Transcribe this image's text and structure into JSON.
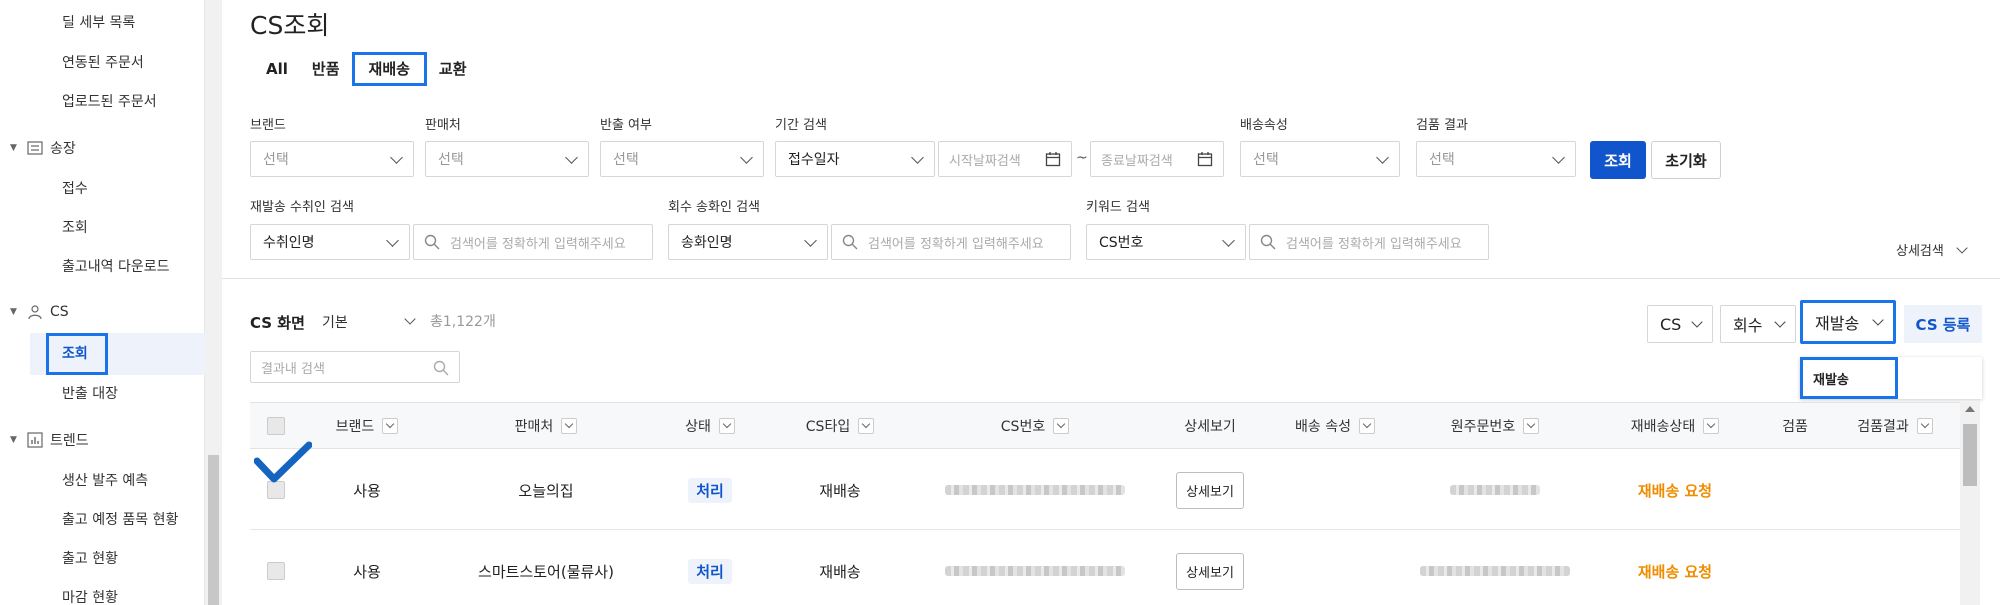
{
  "sidebar": {
    "items_top": [
      "딜 세부 목록",
      "연동된 주문서",
      "업로드된 주문서"
    ],
    "groups": [
      {
        "label": "송장",
        "icon": "document-icon",
        "items": [
          "접수",
          "조회",
          "출고내역 다운로드"
        ]
      },
      {
        "label": "CS",
        "icon": "user-icon",
        "items": [
          "조회",
          "반출 대장"
        ],
        "active_item": "조회"
      },
      {
        "label": "트렌드",
        "icon": "chart-icon",
        "items": [
          "생산 발주 예측",
          "출고 예정 품목 현황",
          "출고 현황",
          "마감 현황"
        ]
      }
    ]
  },
  "page": {
    "title": "CS조회",
    "tabs": [
      "All",
      "반품",
      "재배송",
      "교환"
    ],
    "active_tab": "재배송"
  },
  "filters": {
    "brand": {
      "label": "브랜드",
      "value": "선택"
    },
    "seller": {
      "label": "판매처",
      "value": "선택"
    },
    "release": {
      "label": "반출 여부",
      "value": "선택"
    },
    "period": {
      "label": "기간 검색",
      "type_value": "접수일자",
      "start_placeholder": "시작날짜검색",
      "tilde": "~",
      "end_placeholder": "종료날짜검색"
    },
    "ship_attr": {
      "label": "배송속성",
      "value": "선택"
    },
    "inspect": {
      "label": "검품 결과",
      "value": "선택"
    },
    "search_button": "조회",
    "reset_button": "초기화",
    "reship_receiver": {
      "label": "재발송 수취인 검색",
      "type_value": "수취인명",
      "placeholder": "검색어를 정확하게 입력해주세요"
    },
    "return_sender": {
      "label": "회수 송화인 검색",
      "type_value": "송화인명",
      "placeholder": "검색어를 정확하게 입력해주세요"
    },
    "keyword": {
      "label": "키워드 검색",
      "type_value": "CS번호",
      "placeholder": "검색어를 정확하게 입력해주세요"
    },
    "detail_search": "상세검색"
  },
  "list": {
    "title": "CS 화면",
    "view": "기본",
    "total": "총1,122개",
    "result_search_placeholder": "결과내 검색",
    "select_cs": "CS",
    "select_return": "회수",
    "select_reship": "재발송",
    "register_button": "CS 등록",
    "dropdown_option": "재발송"
  },
  "table": {
    "columns": [
      "브랜드",
      "판매처",
      "상태",
      "CS타입",
      "CS번호",
      "상세보기",
      "배송 속성",
      "원주문번호",
      "재배송상태",
      "검품",
      "검품결과"
    ],
    "rows": [
      {
        "brand": "사용",
        "seller": "오늘의집",
        "status": "처리",
        "cs_type": "재배송",
        "detail": "상세보기",
        "reship_status": "재배송 요청"
      },
      {
        "brand": "사용",
        "seller": "스마트스토어(물류사)",
        "status": "처리",
        "cs_type": "재배송",
        "detail": "상세보기",
        "reship_status": "재배송 요청"
      }
    ]
  },
  "colors": {
    "accent": "#1155cc",
    "highlight": "#1a73e8",
    "orange": "#f08c00"
  }
}
